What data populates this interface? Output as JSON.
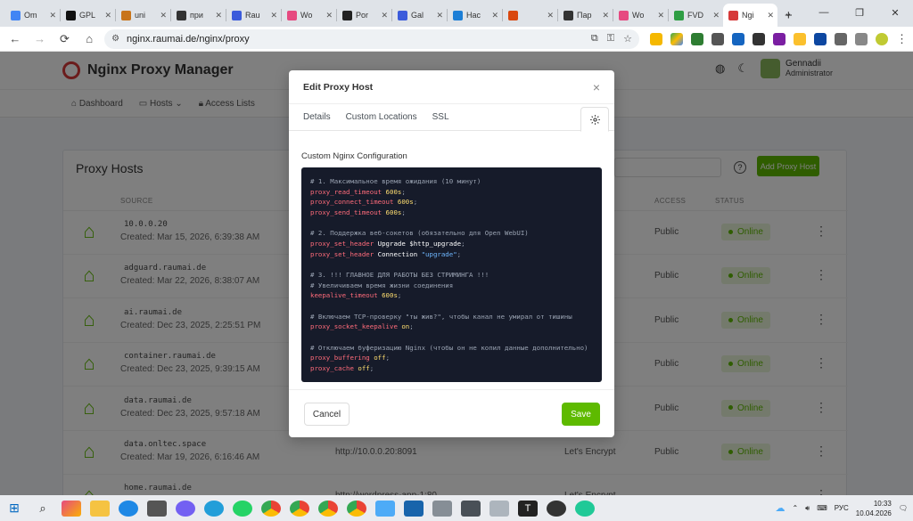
{
  "browser": {
    "tabs": [
      {
        "label": "Om",
        "color": "#4285f4"
      },
      {
        "label": "GPL",
        "color": "#111111"
      },
      {
        "label": "uni",
        "color": "#c8741a"
      },
      {
        "label": "при",
        "color": "#333333"
      },
      {
        "label": "Rau",
        "color": "#3b5bdb"
      },
      {
        "label": "Wo",
        "color": "#e64980"
      },
      {
        "label": "Por",
        "color": "#222222"
      },
      {
        "label": "Gal",
        "color": "#3b5bdb"
      },
      {
        "label": "Нас",
        "color": "#1c7ed6"
      },
      {
        "label": "",
        "color": "#d9480f"
      },
      {
        "label": "Пар",
        "color": "#333333"
      },
      {
        "label": "Wo",
        "color": "#e64980"
      },
      {
        "label": "FVD",
        "color": "#2f9e44"
      },
      {
        "label": "Ngi",
        "color": "#d63939",
        "active": true
      }
    ],
    "new_tab": "+",
    "url": "nginx.raumai.de/nginx/proxy",
    "back_icon": "←",
    "forward_icon": "→",
    "reload_icon": "⟳",
    "home_icon": "⌂"
  },
  "app": {
    "brand": "Nginx Proxy Manager",
    "user_name": "Gennadii",
    "user_role": "Administrator",
    "nav": [
      "Dashboard",
      "Hosts",
      "Access Lists"
    ],
    "card_title": "Proxy Hosts",
    "add_button": "Add Proxy Host",
    "columns": {
      "source": "SOURCE",
      "access": "ACCESS",
      "status": "STATUS"
    },
    "rows": [
      {
        "domain": "10.0.0.20",
        "created": "Created: Mar 15, 2026, 6:39:38 AM",
        "dest": "",
        "ssl": "",
        "access": "Public",
        "status": "Online"
      },
      {
        "domain": "adguard.raumai.de",
        "created": "Created: Mar 22, 2026, 8:38:07 AM",
        "dest": "",
        "ssl": "",
        "access": "Public",
        "status": "Online"
      },
      {
        "domain": "ai.raumai.de",
        "created": "Created: Dec 23, 2025, 2:25:51 PM",
        "dest": "",
        "ssl": "",
        "access": "Public",
        "status": "Online"
      },
      {
        "domain": "container.raumai.de",
        "created": "Created: Dec 23, 2025, 9:39:15 AM",
        "dest": "",
        "ssl": "",
        "access": "Public",
        "status": "Online"
      },
      {
        "domain": "data.raumai.de",
        "created": "Created: Dec 23, 2025, 9:57:18 AM",
        "dest": "",
        "ssl": "",
        "access": "Public",
        "status": "Online"
      },
      {
        "domain": "data.onltec.space",
        "created": "Created: Mar 19, 2026, 6:16:46 AM",
        "dest": "http://10.0.0.20:8091",
        "ssl": "Let's Encrypt",
        "access": "Public",
        "status": "Online"
      },
      {
        "domain": "home.raumai.de",
        "created": "",
        "dest": "http://wordpress-app-1:80",
        "ssl": "Let's Encrypt",
        "access": "",
        "status": ""
      }
    ]
  },
  "modal": {
    "title": "Edit Proxy Host",
    "close": "×",
    "tabs": [
      "Details",
      "Custom Locations",
      "SSL"
    ],
    "section_label": "Custom Nginx Configuration",
    "code_lines": [
      [
        {
          "t": "c",
          "v": "# 1. Максимальное время ожидания (10 минут)"
        }
      ],
      [
        {
          "t": "d",
          "v": "proxy_read_timeout"
        },
        {
          "t": "w",
          "v": " "
        },
        {
          "t": "v",
          "v": "600s"
        },
        {
          "t": "p",
          "v": ";"
        }
      ],
      [
        {
          "t": "d",
          "v": "proxy_connect_timeout"
        },
        {
          "t": "w",
          "v": " "
        },
        {
          "t": "v",
          "v": "600s"
        },
        {
          "t": "p",
          "v": ";"
        }
      ],
      [
        {
          "t": "d",
          "v": "proxy_send_timeout"
        },
        {
          "t": "w",
          "v": " "
        },
        {
          "t": "v",
          "v": "600s"
        },
        {
          "t": "p",
          "v": ";"
        }
      ],
      [],
      [
        {
          "t": "c",
          "v": "# 2. Поддержка веб-сокетов (обязательно для Open WebUI)"
        }
      ],
      [
        {
          "t": "d",
          "v": "proxy_set_header"
        },
        {
          "t": "w",
          "v": " Upgrade $http_upgrade"
        },
        {
          "t": "p",
          "v": ";"
        }
      ],
      [
        {
          "t": "d",
          "v": "proxy_set_header"
        },
        {
          "t": "w",
          "v": " Connection "
        },
        {
          "t": "s",
          "v": "\"upgrade\""
        },
        {
          "t": "p",
          "v": ";"
        }
      ],
      [],
      [
        {
          "t": "c",
          "v": "# 3. !!! ГЛАВНОЕ ДЛЯ РАБОТЫ БЕЗ СТРИМИНГА !!!"
        }
      ],
      [
        {
          "t": "c",
          "v": "# Увеличиваем время жизни соединения"
        }
      ],
      [
        {
          "t": "d",
          "v": "keepalive_timeout"
        },
        {
          "t": "w",
          "v": " "
        },
        {
          "t": "v",
          "v": "600s"
        },
        {
          "t": "p",
          "v": ";"
        }
      ],
      [],
      [
        {
          "t": "c",
          "v": "# Включаем TCP-проверку \"ты жив?\", чтобы канал не умирал от тишины"
        }
      ],
      [
        {
          "t": "d",
          "v": "proxy_socket_keepalive"
        },
        {
          "t": "w",
          "v": " "
        },
        {
          "t": "v",
          "v": "on"
        },
        {
          "t": "p",
          "v": ";"
        }
      ],
      [],
      [
        {
          "t": "c",
          "v": "# Отключаем буферизацию Nginx (чтобы он не копил данные дополнительно)"
        }
      ],
      [
        {
          "t": "d",
          "v": "proxy_buffering"
        },
        {
          "t": "w",
          "v": " "
        },
        {
          "t": "v",
          "v": "off"
        },
        {
          "t": "p",
          "v": ";"
        }
      ],
      [
        {
          "t": "d",
          "v": "proxy_cache"
        },
        {
          "t": "w",
          "v": " "
        },
        {
          "t": "v",
          "v": "off"
        },
        {
          "t": "p",
          "v": ";"
        }
      ]
    ],
    "cancel": "Cancel",
    "save": "Save",
    "accent": "#5eba00"
  },
  "taskbar": {
    "lang": "РУС",
    "time": "10:33",
    "date": "10.04.2026"
  }
}
